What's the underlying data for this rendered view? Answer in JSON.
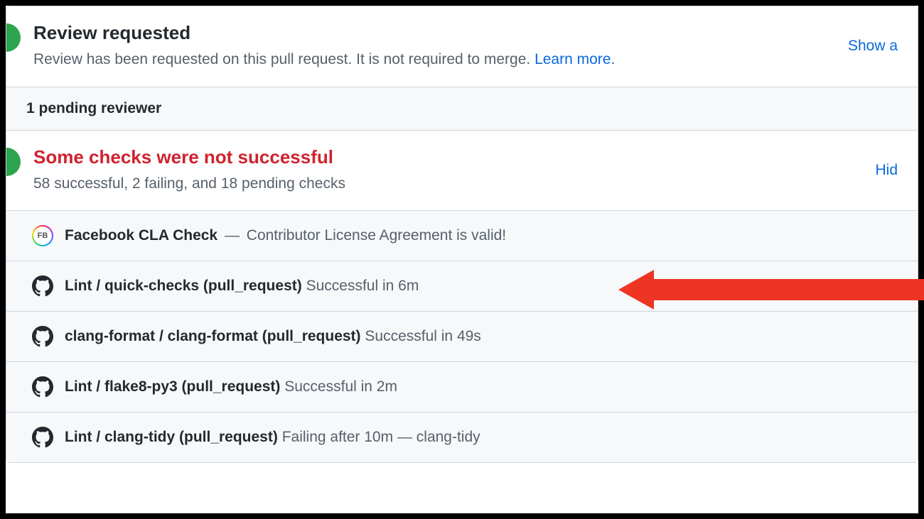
{
  "review": {
    "title": "Review requested",
    "description": "Review has been requested on this pull request. It is not required to merge.",
    "learn_more": "Learn more.",
    "show_action": "Show a",
    "pending_text": "1 pending reviewer"
  },
  "checks_summary": {
    "title": "Some checks were not successful",
    "subtitle": "58 successful, 2 failing, and 18 pending checks",
    "hide_action": "Hid"
  },
  "checks": [
    {
      "icon": "fb",
      "name": "Facebook CLA Check",
      "sep": " — ",
      "detail": "Contributor License Agreement is valid!"
    },
    {
      "icon": "gh",
      "name": "Lint / quick-checks (pull_request)",
      "sep": "",
      "detail": "Successful in 6m"
    },
    {
      "icon": "gh",
      "name": "clang-format / clang-format (pull_request)",
      "sep": "",
      "detail": "Successful in 49s"
    },
    {
      "icon": "gh",
      "name": "Lint / flake8-py3 (pull_request)",
      "sep": "",
      "detail": "Successful in 2m"
    },
    {
      "icon": "gh",
      "name": "Lint / clang-tidy (pull_request)",
      "sep": "",
      "detail": "Failing after 10m — clang-tidy"
    }
  ],
  "fb_badge_text": "FB"
}
